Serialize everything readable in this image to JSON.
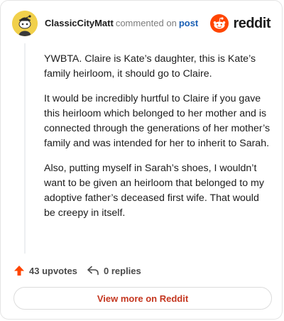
{
  "comment": {
    "username": "ClassicCityMatt",
    "action_text": "commented on",
    "post_link_label": "post",
    "paragraphs": [
      "YWBTA. Claire is Kate’s daughter, this is Kate’s family heirloom, it should go to Claire.",
      "It would be incredibly hurtful to Claire if you gave this heirloom which belonged to her mother and is connected through the generations of her mother’s family and was intended for her to inherit to Sarah.",
      "Also, putting myself in Sarah’s shoes, I wouldn’t want to be given an heirloom that belonged to my adoptive father’s deceased first wife. That would be creepy in itself."
    ]
  },
  "brand": {
    "name": "reddit",
    "icon": "reddit-snoo-icon",
    "color": "#ff4500"
  },
  "footer": {
    "upvotes_label": "43 upvotes",
    "replies_label": "0 replies"
  },
  "view_more_label": "View more on Reddit",
  "colors": {
    "accent": "#ff4500",
    "link": "#1a5fb4",
    "button_text": "#c4361f",
    "avatar_bg": "#f1d04b"
  }
}
